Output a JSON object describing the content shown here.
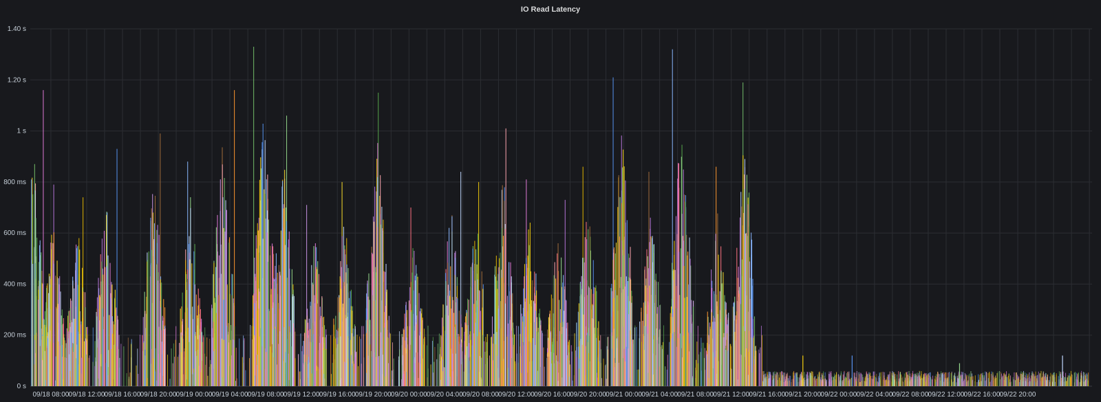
{
  "panel": {
    "title": "IO Read Latency"
  },
  "chart_data": {
    "type": "line",
    "title": "IO Read Latency",
    "xlabel": "",
    "ylabel": "",
    "ylim": [
      0,
      1.4
    ],
    "y_unit": "s",
    "y_ticks": [
      {
        "value": 0,
        "label": "0 s"
      },
      {
        "value": 0.2,
        "label": "200 ms"
      },
      {
        "value": 0.4,
        "label": "400 ms"
      },
      {
        "value": 0.6,
        "label": "600 ms"
      },
      {
        "value": 0.8,
        "label": "800 ms"
      },
      {
        "value": 1.0,
        "label": "1 s"
      },
      {
        "value": 1.2,
        "label": "1.20 s"
      },
      {
        "value": 1.4,
        "label": "1.40 s"
      }
    ],
    "x_tick_labels": [
      "09/18 08:00",
      "09/18 12:00",
      "09/18 16:00",
      "09/18 20:00",
      "09/19 00:00",
      "09/19 04:00",
      "09/19 08:00",
      "09/19 12:00",
      "09/19 16:00",
      "09/19 20:00",
      "09/20 00:00",
      "09/20 04:00",
      "09/20 08:00",
      "09/20 12:00",
      "09/20 16:00",
      "09/20 20:00",
      "09/21 00:00",
      "09/21 04:00",
      "09/21 08:00",
      "09/21 12:00",
      "09/21 16:00",
      "09/21 20:00",
      "09/22 00:00",
      "09/22 04:00",
      "09/22 08:00",
      "09/22 12:00",
      "09/22 16:00",
      "09/22 20:00"
    ],
    "x_range_hours": [
      -2.3,
      116.3
    ],
    "grid": true,
    "legend": "none",
    "series_colors": [
      "#e07ad8",
      "#73bf69",
      "#f2cc0c",
      "#8ab8ff",
      "#ff7383",
      "#5794f2",
      "#fade2a",
      "#b877d9",
      "#96d98d",
      "#ffa6b0",
      "#ff9830",
      "#c0d8ff",
      "#a16d3c",
      "#56a64b",
      "#e0b400",
      "#ca95e5"
    ],
    "bursts": [
      {
        "hour": -2.0,
        "peak": 1.16
      },
      {
        "hour": 0.3,
        "peak": 0.79
      },
      {
        "hour": 3.0,
        "peak": 0.74
      },
      {
        "hour": 6.2,
        "peak": 0.93
      },
      {
        "hour": 11.5,
        "peak": 0.99
      },
      {
        "hour": 15.6,
        "peak": 0.88
      },
      {
        "hour": 19.2,
        "peak": 1.16
      },
      {
        "hour": 23.8,
        "peak": 1.33
      },
      {
        "hour": 26.0,
        "peak": 1.06
      },
      {
        "hour": 29.5,
        "peak": 0.71
      },
      {
        "hour": 32.8,
        "peak": 0.8
      },
      {
        "hour": 36.5,
        "peak": 1.15
      },
      {
        "hour": 40.5,
        "peak": 0.7
      },
      {
        "hour": 44.7,
        "peak": 0.84
      },
      {
        "hour": 47.5,
        "peak": 0.8
      },
      {
        "hour": 50.5,
        "peak": 1.01
      },
      {
        "hour": 53.5,
        "peak": 0.81
      },
      {
        "hour": 56.7,
        "peak": 0.73
      },
      {
        "hour": 60.0,
        "peak": 0.86
      },
      {
        "hour": 63.8,
        "peak": 1.21
      },
      {
        "hour": 67.0,
        "peak": 0.84
      },
      {
        "hour": 70.5,
        "peak": 1.32
      },
      {
        "hour": 74.5,
        "peak": 0.86
      },
      {
        "hour": 77.5,
        "peak": 1.19
      }
    ],
    "quiet_after_hour": 79.5,
    "quiet_level": 0.05,
    "quiet_spikes": [
      {
        "hour": 84.0,
        "value": 0.12
      },
      {
        "hour": 89.5,
        "value": 0.12
      },
      {
        "hour": 101.5,
        "value": 0.09
      },
      {
        "hour": 113.0,
        "value": 0.12
      }
    ]
  }
}
